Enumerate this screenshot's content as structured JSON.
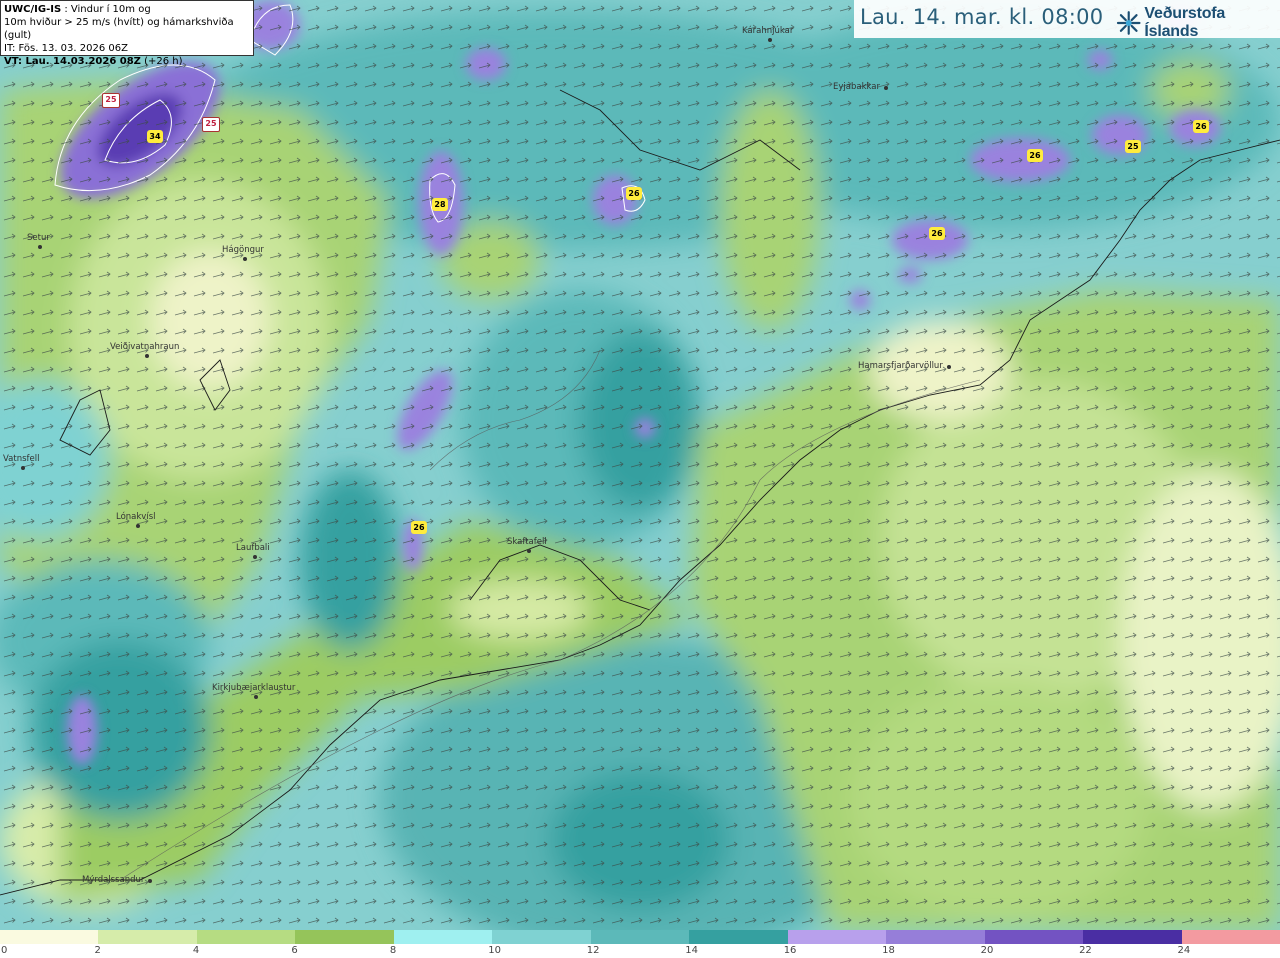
{
  "info": {
    "model": "UWC/IG-IS",
    "description_1": ": Vindur í 10m og",
    "description_2": "10m hviður > 25 m/s (hvítt) og hámarkshviða (gult)",
    "it": "IT: Fös. 13. 03. 2026 06Z",
    "vt_label": "VT: Lau. 14.03.2026 08Z",
    "vt_offset": "(+26 h)"
  },
  "title": {
    "datetime": "Lau. 14. mar. kl. 08:00",
    "logo_text": "Veðurstofa Íslands",
    "logo_icon": "snowflake-icon"
  },
  "places": [
    {
      "name": "Kárahnjúkar"
    },
    {
      "name": "Eyjabakkar"
    },
    {
      "name": "Setur"
    },
    {
      "name": "Hágöngur"
    },
    {
      "name": "Veiðivatnahraun"
    },
    {
      "name": "Vatnsfell"
    },
    {
      "name": "Lónakvísl"
    },
    {
      "name": "Laufbali"
    },
    {
      "name": "Skaftafell"
    },
    {
      "name": "Hamarsfjarðarvöllur"
    },
    {
      "name": "Kirkjubæjarklaustur"
    },
    {
      "name": "Mýrdalssandur"
    }
  ],
  "gust_badges": [
    "34",
    "28",
    "26",
    "26",
    "26",
    "25",
    "26",
    "26"
  ],
  "white_badges": [
    "25",
    "25"
  ],
  "legend": {
    "labels": [
      "0",
      "2",
      "4",
      "6",
      "8",
      "10",
      "12",
      "14",
      "16",
      "18",
      "20",
      "22",
      "24"
    ],
    "colors": [
      "#fafae0",
      "#d6ecaa",
      "#b6dc82",
      "#95c45a",
      "#9ff0f0",
      "#7fd2d2",
      "#5cb9b9",
      "#35a0a0",
      "#b8a0ec",
      "#967ed9",
      "#7353c2",
      "#4a2ea3",
      "#f39aa0"
    ]
  }
}
